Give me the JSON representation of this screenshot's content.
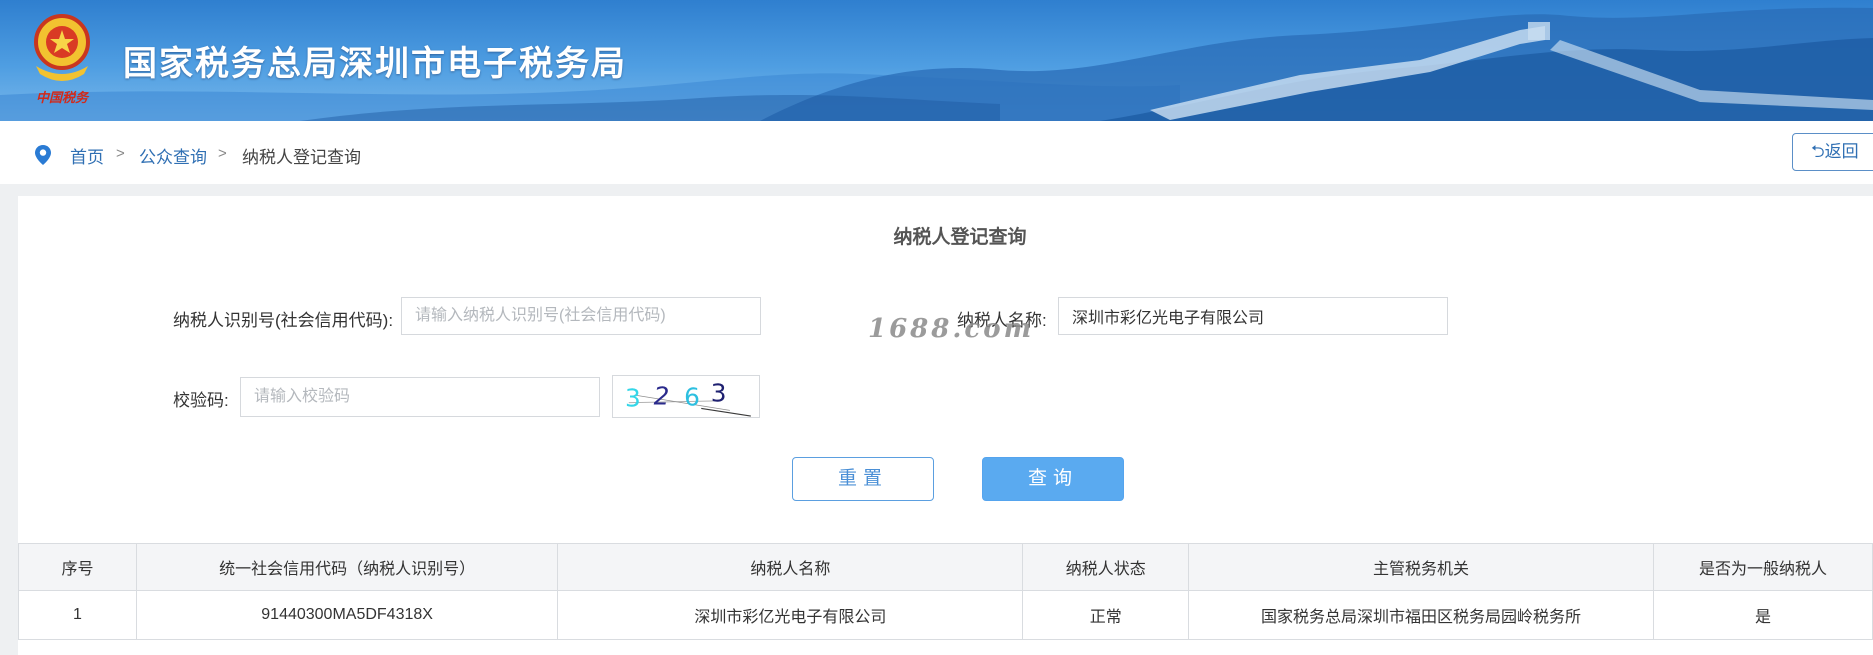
{
  "header": {
    "title": "国家税务总局深圳市电子税务局",
    "emblem_caption": "中国税务",
    "colors": {
      "banner_top": "#2f7fcf",
      "banner_bottom": "#7ab8ea"
    }
  },
  "breadcrumb": {
    "items": [
      "首页",
      "公众查询",
      "纳税人登记查询"
    ],
    "separator": ">"
  },
  "back_button": {
    "label": "返回"
  },
  "form": {
    "title": "纳税人登记查询",
    "taxpayer_id": {
      "label": "纳税人识别号(社会信用代码):",
      "placeholder": "请输入纳税人识别号(社会信用代码)",
      "value": ""
    },
    "taxpayer_name": {
      "label": "纳税人名称:",
      "value": "深圳市彩亿光电子有限公司"
    },
    "captcha": {
      "label": "校验码:",
      "placeholder": "请输入校验码",
      "value": "",
      "image_text": [
        "3",
        "2",
        "6",
        "3"
      ]
    },
    "reset_label": "重置",
    "query_label": "查询"
  },
  "watermark": "1688.com",
  "table": {
    "columns": [
      "序号",
      "统一社会信用代码（纳税人识别号）",
      "纳税人名称",
      "纳税人状态",
      "主管税务机关",
      "是否为一般纳税人"
    ],
    "rows": [
      [
        "1",
        "91440300MA5DF4318X",
        "深圳市彩亿光电子有限公司",
        "正常",
        "国家税务总局深圳市福田区税务局园岭税务所",
        "是"
      ]
    ]
  },
  "colors": {
    "accent": "#5aaaf0",
    "link": "#2f6fb3"
  }
}
